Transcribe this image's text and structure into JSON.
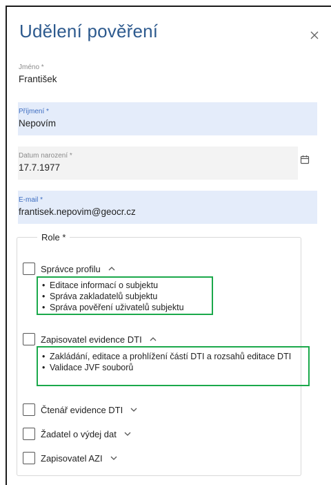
{
  "dialog": {
    "title": "Udělení pověření",
    "close_icon": "close-icon"
  },
  "fields": {
    "first_name": {
      "label": "Jméno *",
      "value": "František"
    },
    "last_name": {
      "label": "Příjmení *",
      "value": "Nepovím"
    },
    "birth_date": {
      "label": "Datum narození *",
      "value": "17.7.1977"
    },
    "email": {
      "label": "E-mail *",
      "value": "frantisek.nepovim@geocr.cz"
    }
  },
  "roles": {
    "legend": "Role *",
    "items": [
      {
        "label": "Správce profilu",
        "expanded": true,
        "checked": false,
        "permissions": [
          "Editace informací o subjektu",
          "Správa zakladatelů subjektu",
          "Správa pověření uživatelů subjektu"
        ]
      },
      {
        "label": "Zapisovatel evidence DTI",
        "expanded": true,
        "checked": false,
        "permissions": [
          "Zakládání, editace a prohlížení částí DTI a rozsahů editace DTI",
          "Validace JVF souborů"
        ]
      },
      {
        "label": "Čtenář evidence DTI",
        "expanded": false,
        "checked": false,
        "permissions": []
      },
      {
        "label": "Žadatel o výdej dat",
        "expanded": false,
        "checked": false,
        "permissions": []
      },
      {
        "label": "Zapisovatel AZI",
        "expanded": false,
        "checked": false,
        "permissions": []
      }
    ]
  },
  "colors": {
    "title": "#2d5a8e",
    "filled_field_bg": "#e4ecfa",
    "highlight_border": "#1aa84a"
  }
}
